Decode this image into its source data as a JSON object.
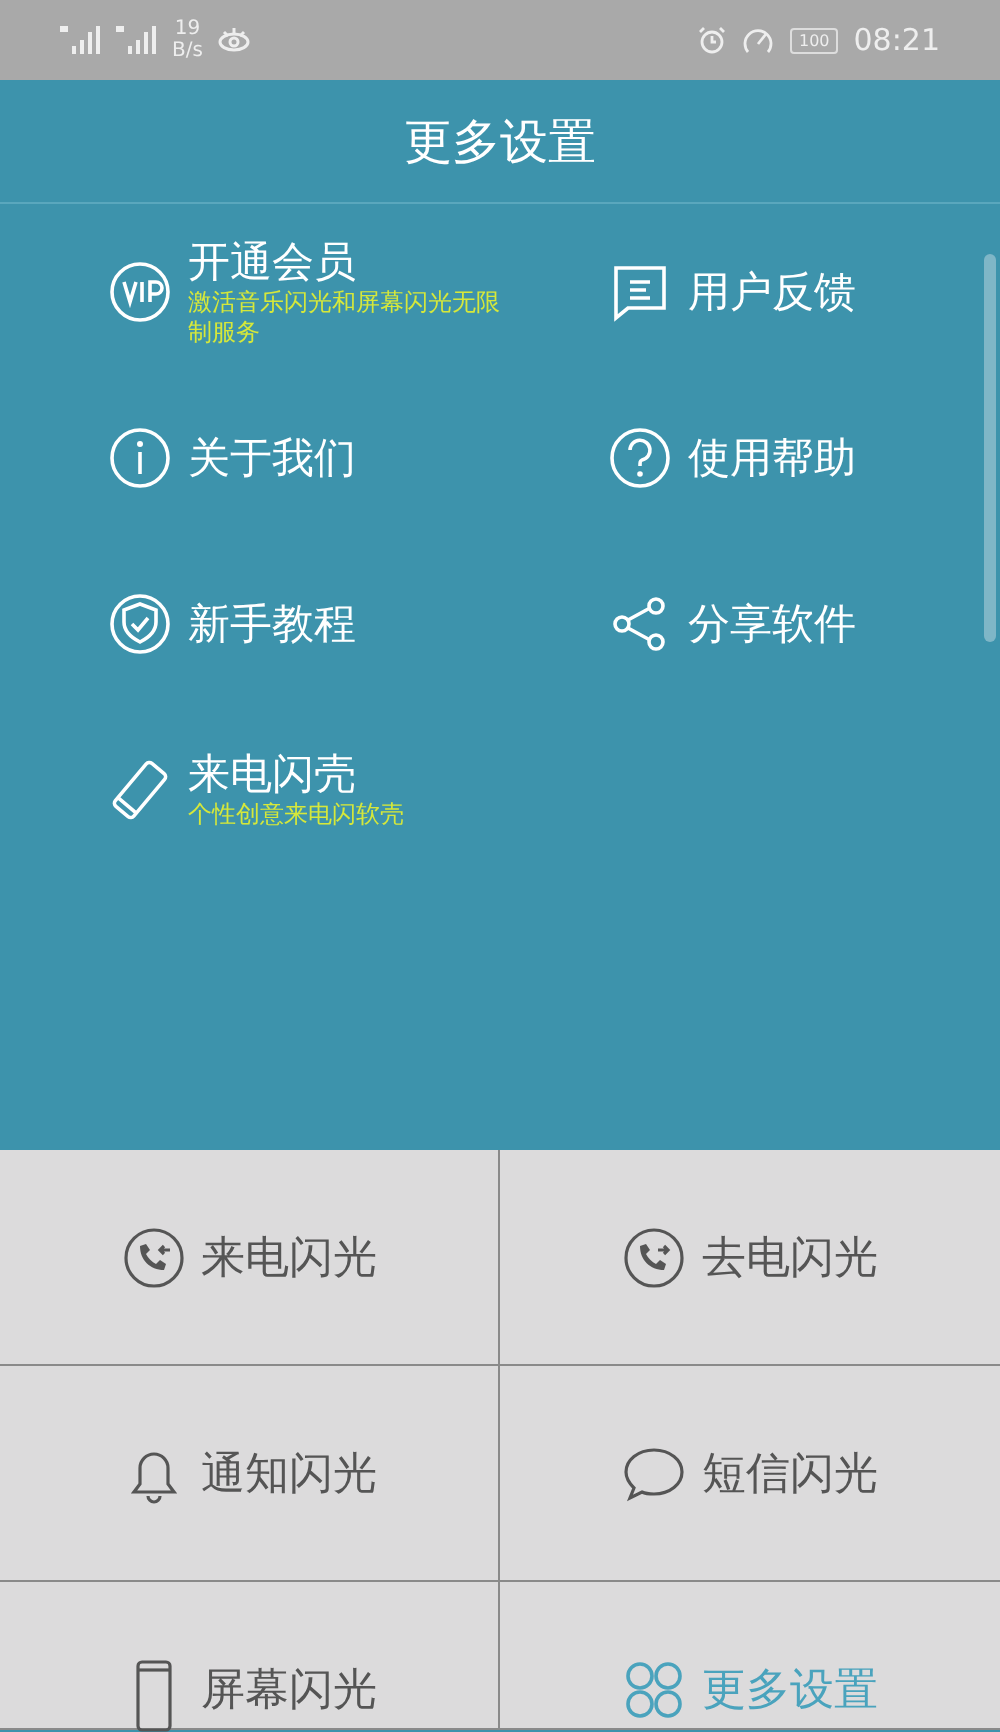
{
  "status_bar": {
    "speed_value": "19",
    "speed_unit": "B/s",
    "battery": "100",
    "time": "08:21"
  },
  "header": {
    "title": "更多设置"
  },
  "menu": [
    {
      "kind": "vip",
      "title": "开通会员",
      "subtitle": "激活音乐闪光和屏幕闪光无限制服务"
    },
    {
      "kind": "feedback",
      "title": "用户反馈"
    },
    {
      "kind": "info",
      "title": "关于我们"
    },
    {
      "kind": "help",
      "title": "使用帮助"
    },
    {
      "kind": "shield",
      "title": "新手教程"
    },
    {
      "kind": "share",
      "title": "分享软件"
    },
    {
      "kind": "phone",
      "title": "来电闪壳",
      "subtitle": "个性创意来电闪软壳"
    }
  ],
  "tiles": [
    {
      "kind": "incoming",
      "label": "来电闪光",
      "selected": false
    },
    {
      "kind": "outgoing",
      "label": "去电闪光",
      "selected": false
    },
    {
      "kind": "bell",
      "label": "通知闪光",
      "selected": false
    },
    {
      "kind": "chat",
      "label": "短信闪光",
      "selected": false
    },
    {
      "kind": "screen",
      "label": "屏幕闪光",
      "selected": false
    },
    {
      "kind": "grid",
      "label": "更多设置",
      "selected": true
    }
  ]
}
